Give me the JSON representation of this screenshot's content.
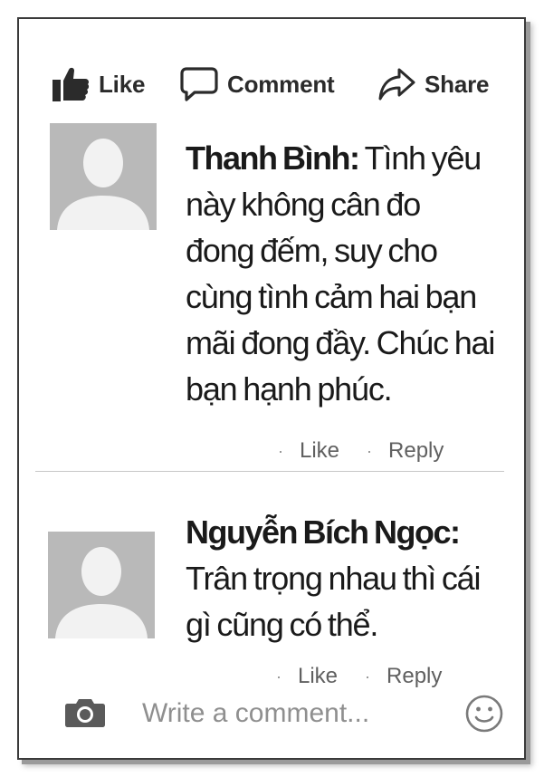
{
  "action_bar": {
    "like_label": "Like",
    "comment_label": "Comment",
    "share_label": "Share"
  },
  "comments": [
    {
      "author": "Thanh Bình:",
      "lines": [
        "Tình yêu",
        "này không cân đo",
        "đong đếm, suy cho",
        "cùng tình cảm hai bạn",
        "mãi đong đầy. Chúc hai",
        "bạn hạnh phúc."
      ],
      "like_label": "Like",
      "reply_label": "Reply"
    },
    {
      "author": "Nguyễn Bích Ngọc:",
      "lines": [
        "Trân trọng nhau thì cái",
        "gì cũng có thể."
      ],
      "like_label": "Like",
      "reply_label": "Reply"
    }
  ],
  "composer": {
    "placeholder": "Write a comment..."
  },
  "icons": {
    "like": "thumbs-up-icon",
    "comment": "speech-bubble-icon",
    "share": "share-arrow-icon",
    "camera": "camera-icon",
    "emoji": "smiley-icon",
    "avatar": "default-avatar-icon"
  },
  "colors": {
    "icon": "#2b2b2b",
    "avatar_bg": "#b9b9b9",
    "avatar_fg": "#f2f2f2",
    "meta_text": "#606060",
    "placeholder": "#8f8f8f"
  }
}
